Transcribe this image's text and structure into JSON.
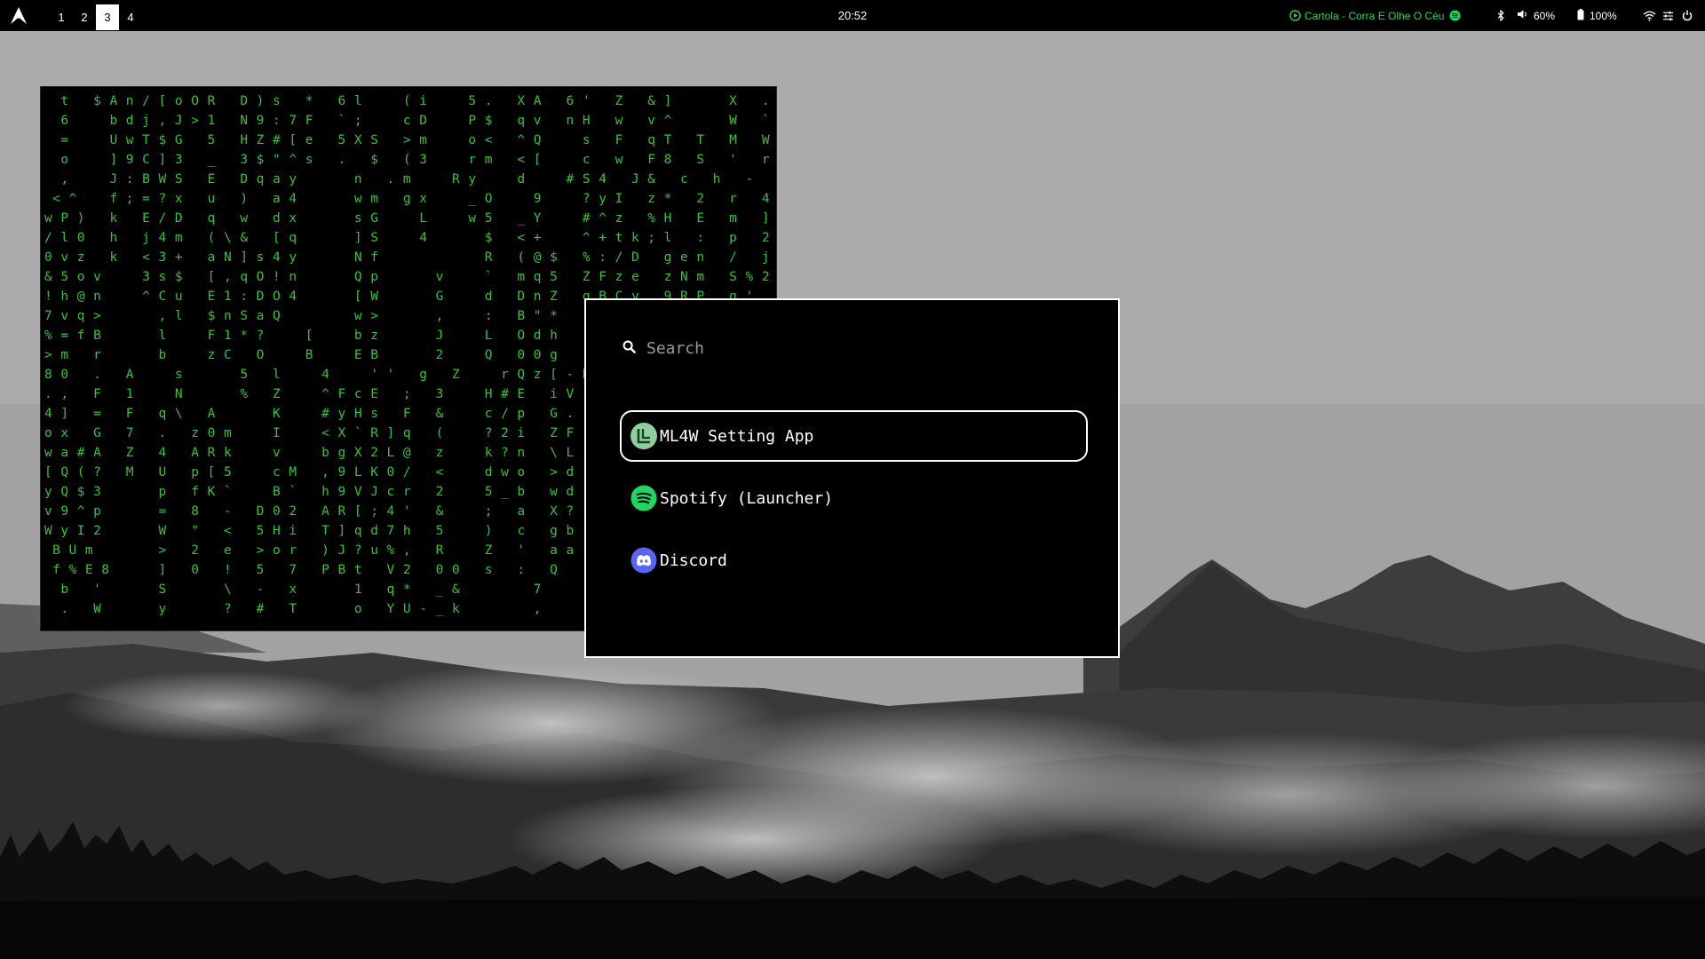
{
  "topbar": {
    "logo_icon": "arch-linux-icon",
    "workspaces": [
      {
        "label": "1",
        "active": false
      },
      {
        "label": "2",
        "active": false
      },
      {
        "label": "3",
        "active": true
      },
      {
        "label": "4",
        "active": false
      }
    ],
    "clock": "20:52",
    "media": {
      "title": "Cartola - Corra E Olhe O Céu",
      "color": "#1ed760"
    },
    "volume": "60%",
    "battery": "100%"
  },
  "terminal": {
    "color": "#3ac13a",
    "lines": [
      "  t   $ A n / [ o O R   D ) s   *   6 l     ( i     5 .   X A   6 '   Z   & ]       X   .",
      "  6     b d j , J > 1   N 9 : 7 F   ` ;     c D     P $   q v   n H   w   v ^       W   `",
      "  =     U w T $ G   5   H Z # [ e   5 X S   > m     o <   ^ Q     s   F   q T   T   M   W",
      "  o     ] 9 C ] 3   _   3 $ \" ^ s   .   $   ( 3     r m   < [     c   w   F 8   S   '   r",
      "  ,     J : B W S   E   D q a y       n   . m     R y     d     # S 4   J &   c   h   -",
      " < ^    f ; = ? x   u   )   a 4       w m   g x     _ O     9     ? y I   z *   2   r   4",
      "w P )   k   E / D   q   w   d x       s G     L     w 5   _ Y     # ^ z   % H   E   m   ]",
      "/ l 0   h   j 4 m   ( \\ &   [ q       ] S     4       $   < +     ^ + t k ; l   :   p   2",
      "0 v z   k   < 3 +   a N ] s 4 y       N f             R   ( @ $   % : / D   g e n   /   j",
      "& 5 o v     3 s $   [ , q O ! n       Q p       v     `   m q 5   Z F z e   z N m   S % 2",
      "! h @ n     ^ C u   E 1 : D O 4       [ W       G     d   D n Z   g B C y   9 R P   g '",
      "7 v q >       , l   $ n S a Q         w >       ,     :   B \" *",
      "% = f B       l     F 1 * ?     [     b z       J     L   O d h",
      "> m   r       b     z C   O     B     E B       2     Q   0 0 g",
      "8 0   .   A     s       5   l     4     ' '   g   Z     r Q z [ - N",
      ". ,   F   1     N       %   Z     ^ F c E   ;   3     H # E   i V",
      "4 ]   =   F   q \\   A       K     # y H s   F   &     c / p   G .",
      "o x   G   7   .   z 0 m     I     < X ` R ] q   (     ? 2 i   Z F",
      "w a # A   Z   4   A R k     v     b g X 2 L @   z     k ? n   \\ L",
      "[ Q ( ?   M   U   p [ 5     c M   , 9 L K 0 /   <     d w o   > d",
      "y Q $ 3       p   f K `     B `   h 9 V J c r   2     5 _ b   w d",
      "v 9 ^ p       =   8   -   D 0 2   A R [ ; 4 '   &     ;   a   X ?",
      "W y I 2       W   \"   <   5 H i   T ] q d 7 h   5     )   c   g b",
      " B U m        >   2   e   > o r   ) J ? u % ,   R     Z   '   a a",
      " f % E 8      ]   0   !   5   7   P B t   V 2   0 0   s   :   Q",
      "  b   '       S       \\   -   x       1   q *   _ &         7",
      "  .   W       y       ?   #   T       o   Y U - _ k         ,"
    ]
  },
  "launcher": {
    "search_placeholder": "Search",
    "entries": [
      {
        "label": "ML4W Setting App",
        "icon": "ml4w-settings-icon",
        "selected": true
      },
      {
        "label": "Spotify (Launcher)",
        "icon": "spotify-icon",
        "selected": false
      },
      {
        "label": "Discord",
        "icon": "discord-icon",
        "selected": false
      }
    ]
  }
}
